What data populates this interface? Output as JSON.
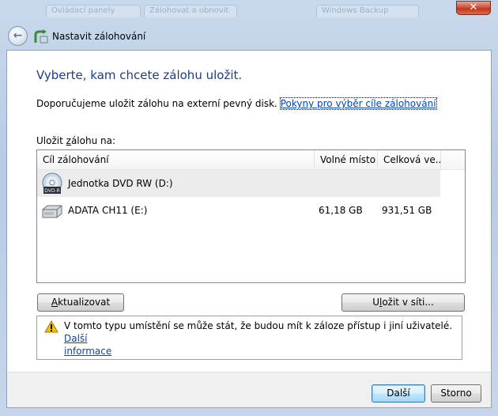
{
  "window": {
    "title": "Nastavit zálohování",
    "background_tabs": [
      "Ovládací panely",
      "Zálohovat a obnovit",
      "Windows Backup"
    ],
    "close_label": "✕"
  },
  "page": {
    "heading": "Vyberte, kam chcete zálohu uložit.",
    "recommendation": "Doporučujeme uložit zálohu na externí pevný disk.",
    "guide_link": "Pokyny pro výběr cíle zálohování",
    "save_label_prefix": "Uložit ",
    "save_label_accel": "z",
    "save_label_rest": "álohu na:"
  },
  "table": {
    "columns": [
      "Cíl zálohování",
      "Volné místo",
      "Celková ve..."
    ],
    "rows": [
      {
        "name": "Jednotka DVD RW (D:)",
        "free": "",
        "total": "",
        "icon": "dvd-drive-icon",
        "selected": true
      },
      {
        "name": "ADATA CH11 (E:)",
        "free": "61,18 GB",
        "total": "931,51 GB",
        "icon": "hard-drive-icon",
        "selected": false
      }
    ]
  },
  "buttons": {
    "refresh_accel": "A",
    "refresh_rest": "ktualizovat",
    "network_prefix": "U",
    "network_accel": "l",
    "network_rest": "ožit v síti...",
    "next": "Další",
    "cancel": "Storno"
  },
  "warning": {
    "text": "V tomto typu umístění se může stát, že budou mít k záloze přístup i jiní uživatelé.",
    "link_1": "Další",
    "link_2": "informace"
  },
  "colors": {
    "heading": "#1e3b8c",
    "link": "#0645ad",
    "selection": "#ececec",
    "warning": "#f2c200"
  }
}
